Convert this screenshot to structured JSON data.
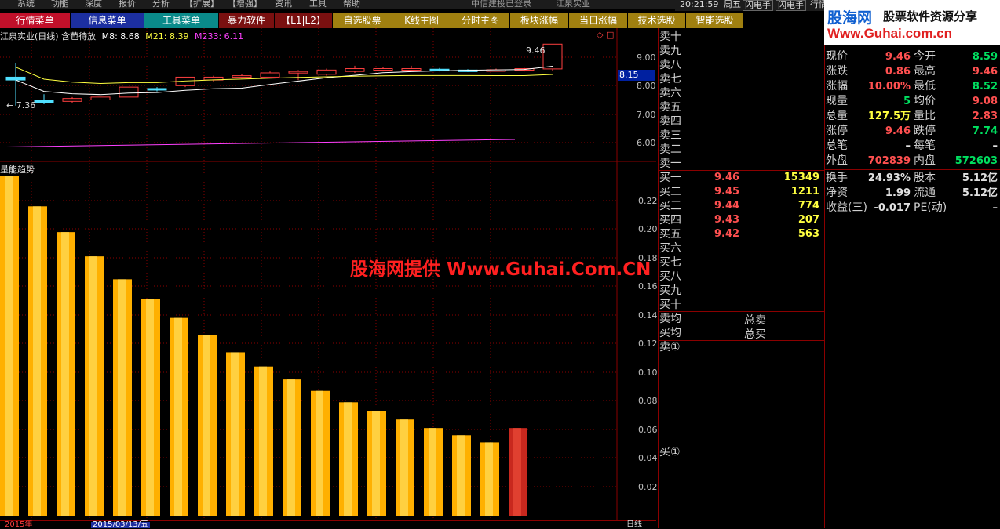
{
  "menubar": {
    "items": [
      "系统",
      "功能",
      "深度",
      "报价",
      "分析",
      "【扩展】",
      "【增强】",
      "资讯",
      "工具",
      "帮助"
    ],
    "status_text": "中信建投已登录",
    "stock_text": "江泉实业"
  },
  "titlebar": {
    "time": "20:21:59",
    "weekday": "周五",
    "buttons": [
      "闪电手",
      "闪电手",
      "行情"
    ]
  },
  "tabs": [
    {
      "label": "行情菜单",
      "bg": "#c0102a"
    },
    {
      "label": "信息菜单",
      "bg": "#1c2fa0"
    },
    {
      "label": "工具菜单",
      "bg": "#0a8a8a"
    },
    {
      "label": "暴力软件",
      "bg": "#7a1010"
    },
    {
      "label": "【L1|L2】",
      "bg": "#7a1010"
    },
    {
      "label": "自选股票",
      "bg": "#a08010"
    },
    {
      "label": "K线主图",
      "bg": "#a08010"
    },
    {
      "label": "分时主图",
      "bg": "#a08010"
    },
    {
      "label": "板块涨幅",
      "bg": "#a08010"
    },
    {
      "label": "当日涨幅",
      "bg": "#a08010"
    },
    {
      "label": "技术选股",
      "bg": "#a08010"
    },
    {
      "label": "智能选股",
      "bg": "#a08010"
    }
  ],
  "kline": {
    "title": "江泉实业(日线)",
    "subtitle": "含苞待放",
    "ma": [
      {
        "label": "M8: 8.68",
        "color": "#ffffff"
      },
      {
        "label": "M21: 8.39",
        "color": "#ffff40"
      },
      {
        "label": "M233: 6.11",
        "color": "#ff40ff"
      }
    ],
    "high_label": "9.46",
    "low_label": "7.36",
    "current_price_tag": "8.15",
    "y_ticks": [
      "9.00",
      "8.00",
      "7.00",
      "6.00"
    ],
    "candles": [
      {
        "o": 8.3,
        "c": 8.2,
        "h": 8.8,
        "l": 7.3
      },
      {
        "o": 7.5,
        "c": 7.4,
        "h": 7.7,
        "l": 7.35
      },
      {
        "o": 7.45,
        "c": 7.55,
        "h": 7.6,
        "l": 7.4
      },
      {
        "o": 7.5,
        "c": 7.6,
        "h": 7.6,
        "l": 7.5
      },
      {
        "o": 7.6,
        "c": 7.95,
        "h": 7.95,
        "l": 7.6
      },
      {
        "o": 7.9,
        "c": 7.85,
        "h": 7.95,
        "l": 7.8
      },
      {
        "o": 8.0,
        "c": 8.3,
        "h": 8.3,
        "l": 7.95
      },
      {
        "o": 8.2,
        "c": 8.3,
        "h": 8.35,
        "l": 8.15
      },
      {
        "o": 8.3,
        "c": 8.35,
        "h": 8.4,
        "l": 8.25
      },
      {
        "o": 8.3,
        "c": 8.45,
        "h": 8.5,
        "l": 8.3
      },
      {
        "o": 8.45,
        "c": 8.5,
        "h": 8.55,
        "l": 8.2
      },
      {
        "o": 8.4,
        "c": 8.55,
        "h": 8.6,
        "l": 8.35
      },
      {
        "o": 8.5,
        "c": 8.6,
        "h": 8.7,
        "l": 8.45
      },
      {
        "o": 8.55,
        "c": 8.6,
        "h": 8.65,
        "l": 8.5
      },
      {
        "o": 8.55,
        "c": 8.6,
        "h": 8.7,
        "l": 8.5
      },
      {
        "o": 8.58,
        "c": 8.52,
        "h": 8.62,
        "l": 8.5
      },
      {
        "o": 8.55,
        "c": 8.52,
        "h": 8.58,
        "l": 8.48
      },
      {
        "o": 8.52,
        "c": 8.56,
        "h": 8.6,
        "l": 8.5
      },
      {
        "o": 8.55,
        "c": 8.6,
        "h": 8.62,
        "l": 8.5
      },
      {
        "o": 8.59,
        "c": 9.46,
        "h": 9.46,
        "l": 8.52
      }
    ]
  },
  "volume_panel": {
    "title": "量能趋势",
    "y_ticks": [
      "0.22",
      "0.20",
      "0.18",
      "0.16",
      "0.14",
      "0.12",
      "0.10",
      "0.08",
      "0.06",
      "0.04",
      "0.02"
    ],
    "bars": [
      0.237,
      0.216,
      0.198,
      0.181,
      0.165,
      0.151,
      0.138,
      0.126,
      0.114,
      0.104,
      0.095,
      0.087,
      0.079,
      0.073,
      0.067,
      0.061,
      0.056,
      0.051,
      0.061
    ],
    "last_bar_color": "#c8281e"
  },
  "bottom": {
    "year": "2015年",
    "date": "2015/03/13/五",
    "tab": "日线"
  },
  "watermark": "股海网提供 Www.Guhai.Com.CN",
  "brand": {
    "logo": "股海网",
    "tagline": "股票软件资源分享",
    "url": "Www.Guhai.com.cn"
  },
  "orderbook": {
    "asks": [
      "卖十",
      "卖九",
      "卖八",
      "卖七",
      "卖六",
      "卖五",
      "卖四",
      "卖三",
      "卖二",
      "卖一"
    ],
    "bids": [
      {
        "label": "买一",
        "price": "9.46",
        "vol": "15349"
      },
      {
        "label": "买二",
        "price": "9.45",
        "vol": "1211"
      },
      {
        "label": "买三",
        "price": "9.44",
        "vol": "774"
      },
      {
        "label": "买四",
        "price": "9.43",
        "vol": "207"
      },
      {
        "label": "买五",
        "price": "9.42",
        "vol": "563"
      },
      {
        "label": "买六",
        "price": "",
        "vol": ""
      },
      {
        "label": "买七",
        "price": "",
        "vol": ""
      },
      {
        "label": "买八",
        "price": "",
        "vol": ""
      },
      {
        "label": "买九",
        "price": "",
        "vol": ""
      },
      {
        "label": "买十",
        "price": "",
        "vol": ""
      }
    ],
    "avg_sell": "卖均",
    "avg_buy": "买均",
    "total_sell": "总卖",
    "total_buy": "总买",
    "sell_queue": "卖①",
    "buy_queue": "买①"
  },
  "quote_info": {
    "rows1": [
      {
        "l1": "现价",
        "v1": "9.46",
        "c1": "red",
        "l2": "今开",
        "v2": "8.59",
        "c2": "grn"
      },
      {
        "l1": "涨跌",
        "v1": "0.86",
        "c1": "red",
        "l2": "最高",
        "v2": "9.46",
        "c2": "red"
      },
      {
        "l1": "涨幅",
        "v1": "10.00%",
        "c1": "red",
        "l2": "最低",
        "v2": "8.52",
        "c2": "grn"
      },
      {
        "l1": "现量",
        "v1": "5",
        "c1": "grn",
        "l2": "均价",
        "v2": "9.08",
        "c2": "red"
      },
      {
        "l1": "总量",
        "v1": "127.5万",
        "c1": "yel",
        "l2": "量比",
        "v2": "2.83",
        "c2": "red"
      },
      {
        "l1": "涨停",
        "v1": "9.46",
        "c1": "red",
        "l2": "跌停",
        "v2": "7.74",
        "c2": "grn"
      },
      {
        "l1": "总笔",
        "v1": "–",
        "c1": "wht",
        "l2": "每笔",
        "v2": "–",
        "c2": "wht"
      },
      {
        "l1": "外盘",
        "v1": "702839",
        "c1": "red",
        "l2": "内盘",
        "v2": "572603",
        "c2": "grn"
      }
    ],
    "rows2": [
      {
        "l1": "换手",
        "v1": "24.93%",
        "c1": "wht",
        "l2": "股本",
        "v2": "5.12亿",
        "c2": "wht"
      },
      {
        "l1": "净资",
        "v1": "1.99",
        "c1": "wht",
        "l2": "流通",
        "v2": "5.12亿",
        "c2": "wht"
      },
      {
        "l1": "收益(三)",
        "v1": "-0.017",
        "c1": "wht",
        "l2": "PE(动)",
        "v2": "–",
        "c2": "wht"
      }
    ]
  }
}
